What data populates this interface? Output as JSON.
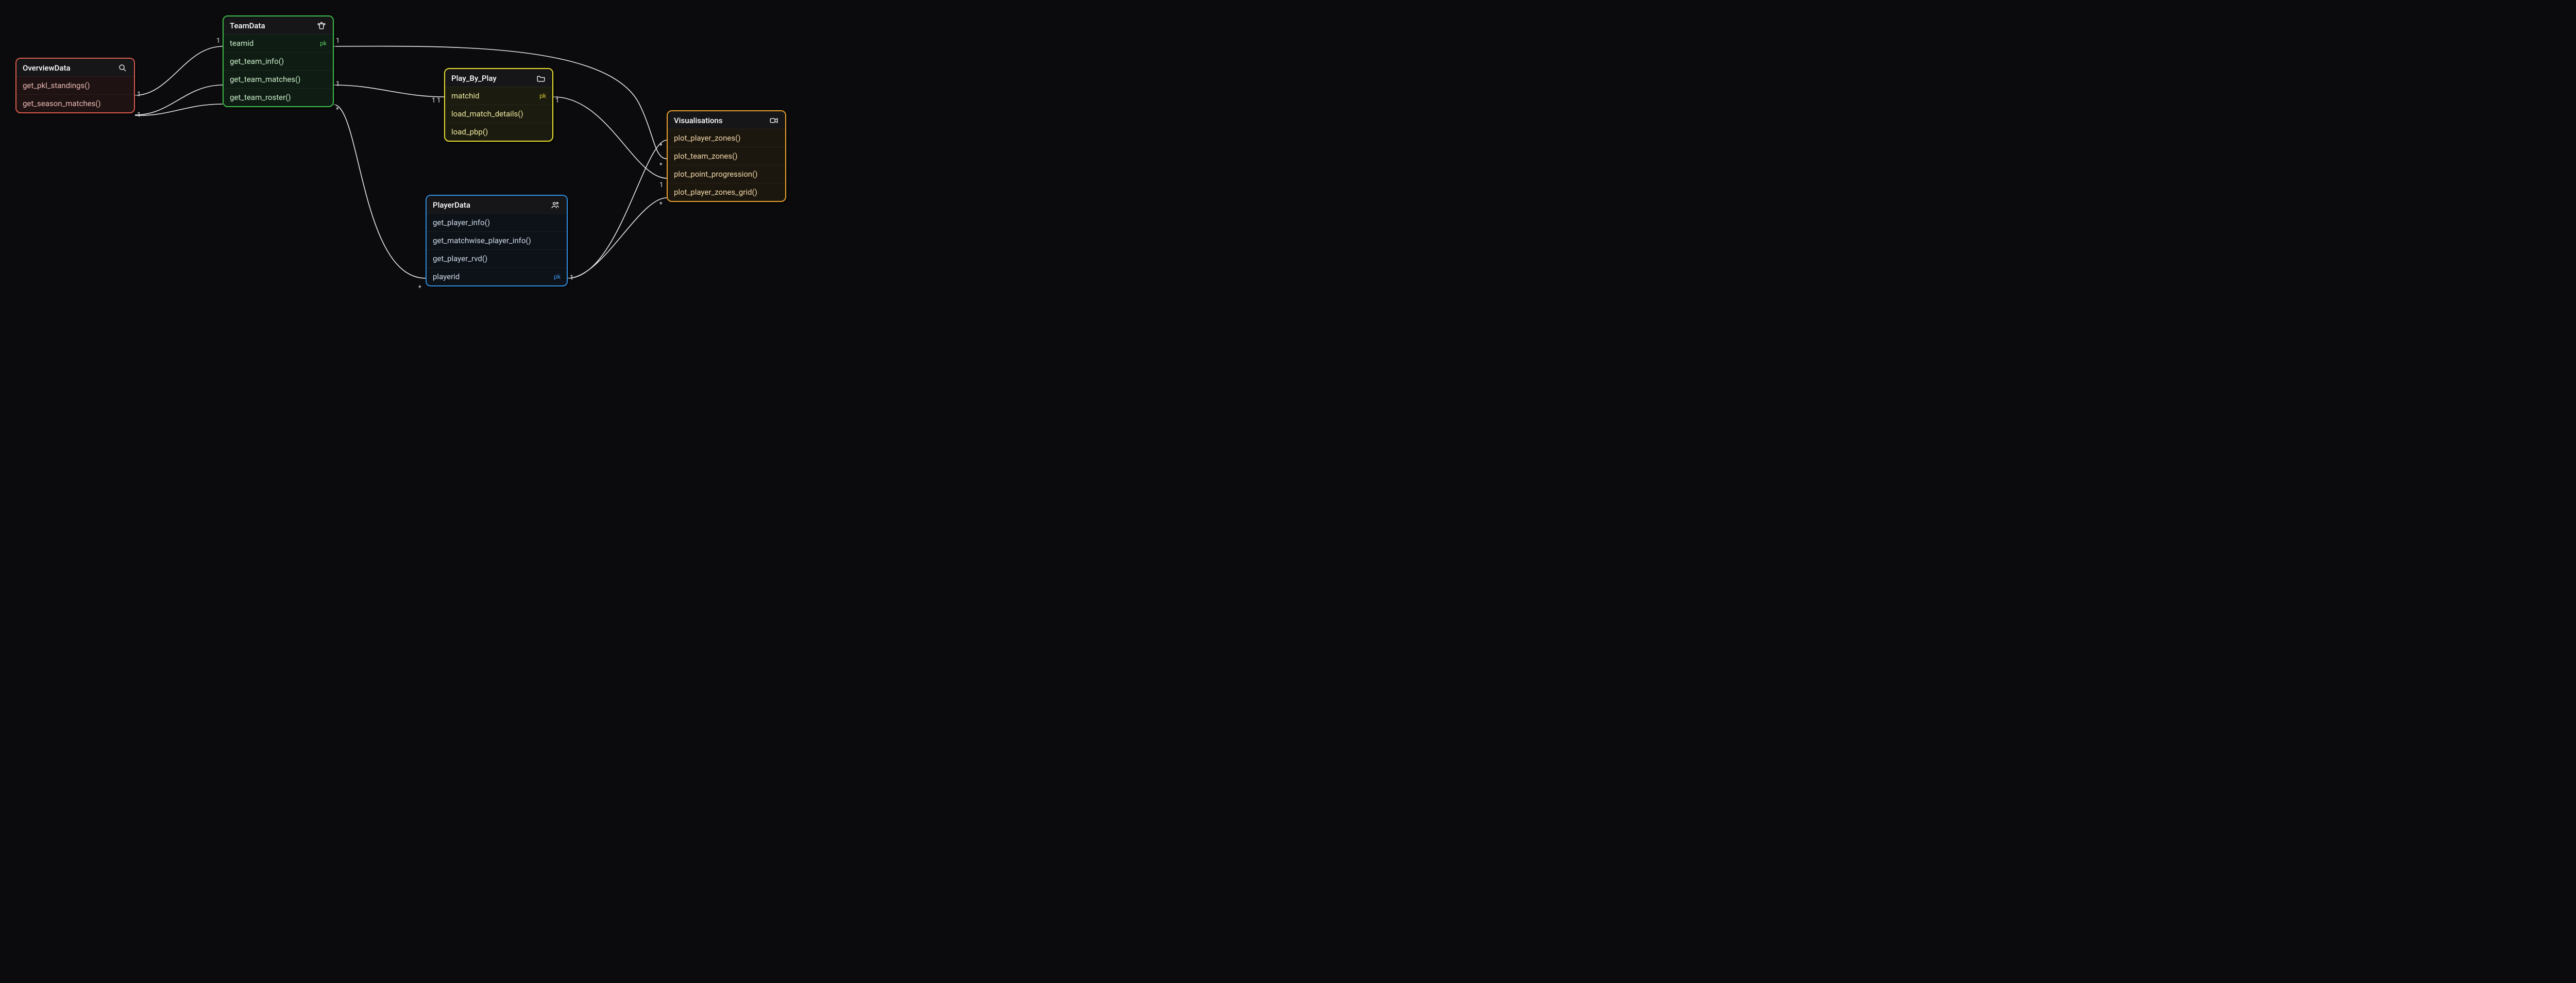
{
  "entities": {
    "overview": {
      "title": "OverviewData",
      "rows": [
        {
          "label": "get_pkl_standings()"
        },
        {
          "label": "get_season_matches()"
        }
      ]
    },
    "team": {
      "title": "TeamData",
      "rows": [
        {
          "label": "teamid",
          "pk": "pk"
        },
        {
          "label": "get_team_info()"
        },
        {
          "label": "get_team_matches()"
        },
        {
          "label": "get_team_roster()"
        }
      ]
    },
    "pbp": {
      "title": "Play_By_Play",
      "rows": [
        {
          "label": "matchid",
          "pk": "pk"
        },
        {
          "label": "load_match_details()"
        },
        {
          "label": "load_pbp()"
        }
      ]
    },
    "player": {
      "title": "PlayerData",
      "rows": [
        {
          "label": "get_player_info()"
        },
        {
          "label": "get_matchwise_player_info()"
        },
        {
          "label": "get_player_rvd()"
        },
        {
          "label": "playerid",
          "pk": "pk"
        }
      ]
    },
    "viz": {
      "title": "Visualisations",
      "rows": [
        {
          "label": "plot_player_zones()"
        },
        {
          "label": "plot_team_zones()"
        },
        {
          "label": "plot_point_progression()"
        },
        {
          "label": "plot_player_zones_grid()"
        }
      ]
    }
  },
  "cardinality_labels": {
    "overview_standings_r": "1",
    "overview_season_r": "1",
    "team_teamid_l": "1",
    "team_teamid_r": "1",
    "team_matches_r": "1",
    "team_roster_r": "*",
    "pbp_matchid_l1": "1",
    "pbp_matchid_l2": "1",
    "pbp_matchid_r": "1",
    "player_playerid_l": "*",
    "player_playerid_r": "1",
    "viz_playerzones_l": "*",
    "viz_teamzones_l": "*",
    "viz_pointprog_l": "1",
    "viz_grid_l": "*"
  }
}
